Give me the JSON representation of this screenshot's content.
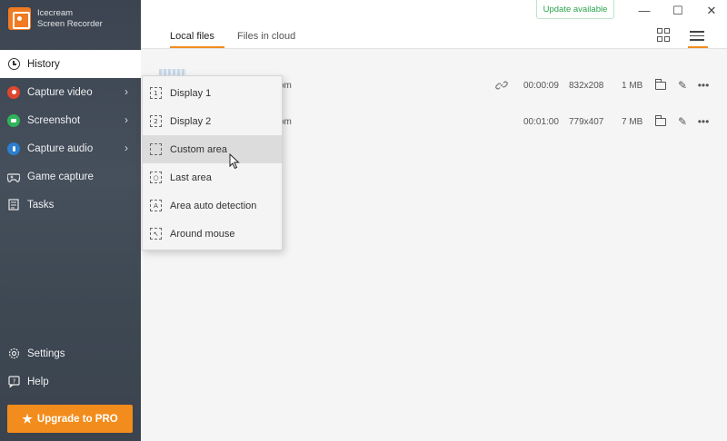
{
  "brand": {
    "line1": "Icecream",
    "line2": "Screen Recorder"
  },
  "sidebar": {
    "items": [
      {
        "label": "History",
        "icon": "clock-icon"
      },
      {
        "label": "Capture video",
        "icon": "record-icon"
      },
      {
        "label": "Screenshot",
        "icon": "camera-icon"
      },
      {
        "label": "Capture audio",
        "icon": "microphone-icon"
      },
      {
        "label": "Game capture",
        "icon": "gamepad-icon"
      },
      {
        "label": "Tasks",
        "icon": "tasks-icon"
      }
    ],
    "settings": "Settings",
    "help": "Help",
    "upgrade": "Upgrade to PRO"
  },
  "header": {
    "tabs": [
      "Local files",
      "Files in cloud"
    ],
    "update": "Update available",
    "minimize": "—",
    "maximize": "☐",
    "close": "✕"
  },
  "files": [
    {
      "name_tail": "om",
      "duration": "00:00:09",
      "resolution": "832x208",
      "size": "1 MB"
    },
    {
      "name_tail": "om",
      "duration": "00:01:00",
      "resolution": "779x407",
      "size": "7 MB"
    }
  ],
  "dropdown": {
    "items": [
      {
        "label": "Display 1",
        "glyph": "1"
      },
      {
        "label": "Display 2",
        "glyph": "2"
      },
      {
        "label": "Custom area",
        "glyph": ""
      },
      {
        "label": "Last area",
        "glyph": "○"
      },
      {
        "label": "Area auto detection",
        "glyph": "A"
      },
      {
        "label": "Around mouse",
        "glyph": "↖"
      }
    ]
  },
  "colors": {
    "accent": "#f28c1c",
    "sidebar": "#434c57",
    "update_green": "#29a34a"
  }
}
